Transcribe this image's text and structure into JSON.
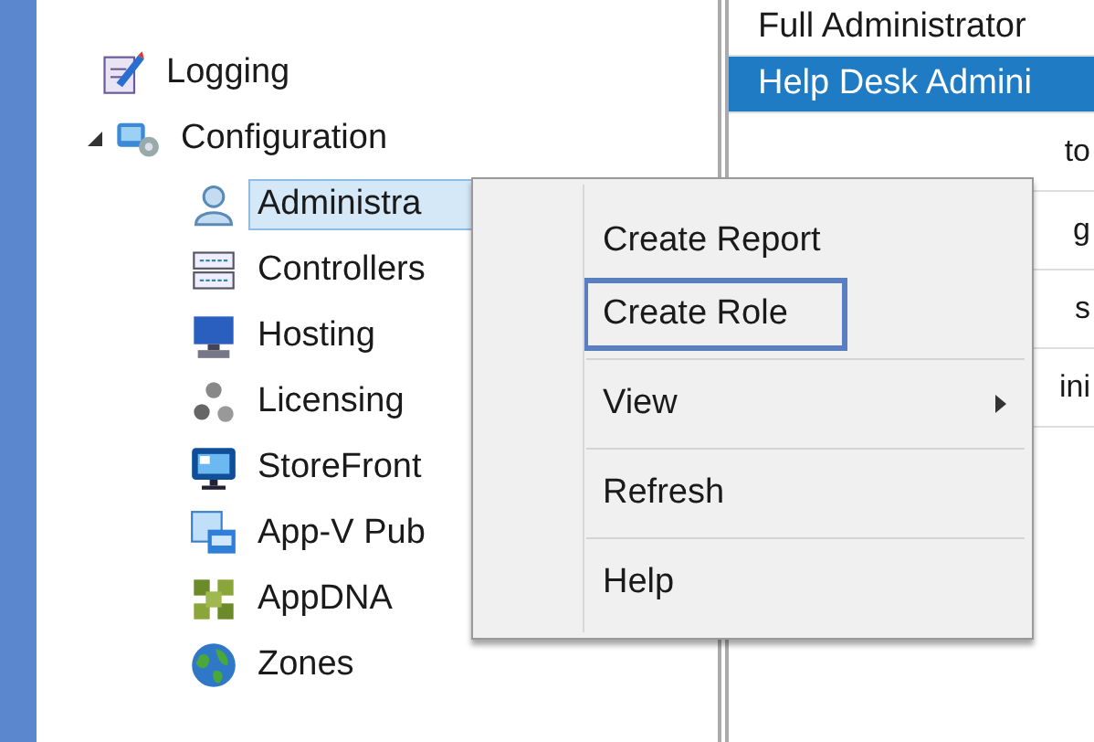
{
  "tree": {
    "items": [
      {
        "label": "Logging",
        "selected": false
      },
      {
        "label": "Configuration",
        "selected": false,
        "expanded": true,
        "children": [
          {
            "label": "Administra",
            "selected": true
          },
          {
            "label": "Controllers",
            "selected": false
          },
          {
            "label": "Hosting",
            "selected": false
          },
          {
            "label": "Licensing",
            "selected": false
          },
          {
            "label": "StoreFront",
            "selected": false
          },
          {
            "label": "App-V Pub",
            "selected": false
          },
          {
            "label": "AppDNA",
            "selected": false
          },
          {
            "label": "Zones",
            "selected": false
          }
        ]
      }
    ]
  },
  "list": {
    "rows": [
      {
        "text": "Full Administrator",
        "selected": false,
        "kind": "full"
      },
      {
        "text": "Help Desk Admini",
        "selected": true,
        "kind": "full"
      },
      {
        "text": "to",
        "selected": false,
        "kind": "partial"
      },
      {
        "text": "g",
        "selected": false,
        "kind": "partial"
      },
      {
        "text": "s",
        "selected": false,
        "kind": "partial"
      },
      {
        "text": "ini",
        "selected": false,
        "kind": "partial"
      }
    ]
  },
  "context_menu": {
    "items": [
      {
        "label": "Create Report",
        "highlighted": false,
        "submenu": false
      },
      {
        "label": "Create Role",
        "highlighted": true,
        "submenu": false
      },
      {
        "label": "View",
        "highlighted": false,
        "submenu": true
      },
      {
        "label": "Refresh",
        "highlighted": false,
        "submenu": false
      },
      {
        "label": "Help",
        "highlighted": false,
        "submenu": false
      }
    ]
  }
}
